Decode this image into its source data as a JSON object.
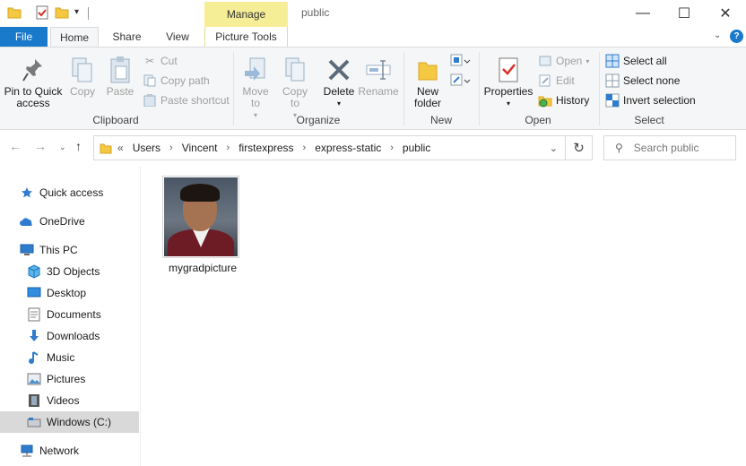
{
  "titlebar": {
    "context_tab": "Manage",
    "title": "public",
    "minimize": "—",
    "maximize": "☐",
    "close": "✕"
  },
  "tabs": {
    "file": "File",
    "home": "Home",
    "share": "Share",
    "view": "View",
    "picture_tools": "Picture Tools"
  },
  "ribbon": {
    "clipboard": {
      "label": "Clipboard",
      "pin": "Pin to Quick access",
      "copy": "Copy",
      "paste": "Paste",
      "cut": "Cut",
      "copy_path": "Copy path",
      "paste_shortcut": "Paste shortcut"
    },
    "organize": {
      "label": "Organize",
      "move_to": "Move to",
      "copy_to": "Copy to",
      "delete": "Delete",
      "rename": "Rename"
    },
    "new": {
      "label": "New",
      "new_folder": "New folder"
    },
    "open": {
      "label": "Open",
      "properties": "Properties",
      "open": "Open",
      "edit": "Edit",
      "history": "History"
    },
    "select": {
      "label": "Select",
      "select_all": "Select all",
      "select_none": "Select none",
      "invert": "Invert selection"
    }
  },
  "address": {
    "overflow": "«",
    "crumbs": [
      "Users",
      "Vincent",
      "firstexpress",
      "express-static",
      "public"
    ],
    "search_placeholder": "Search public"
  },
  "navpane": {
    "quick_access": "Quick access",
    "onedrive": "OneDrive",
    "this_pc": "This PC",
    "objects3d": "3D Objects",
    "desktop": "Desktop",
    "documents": "Documents",
    "downloads": "Downloads",
    "music": "Music",
    "pictures": "Pictures",
    "videos": "Videos",
    "windows_c": "Windows (C:)",
    "network": "Network"
  },
  "files": [
    {
      "name": "mygradpicture"
    }
  ],
  "colors": {
    "file_tab": "#1979ca",
    "manage_tab": "#f6ee96",
    "selected_nav": "#d9d9d9",
    "accent": "#0078d7"
  }
}
